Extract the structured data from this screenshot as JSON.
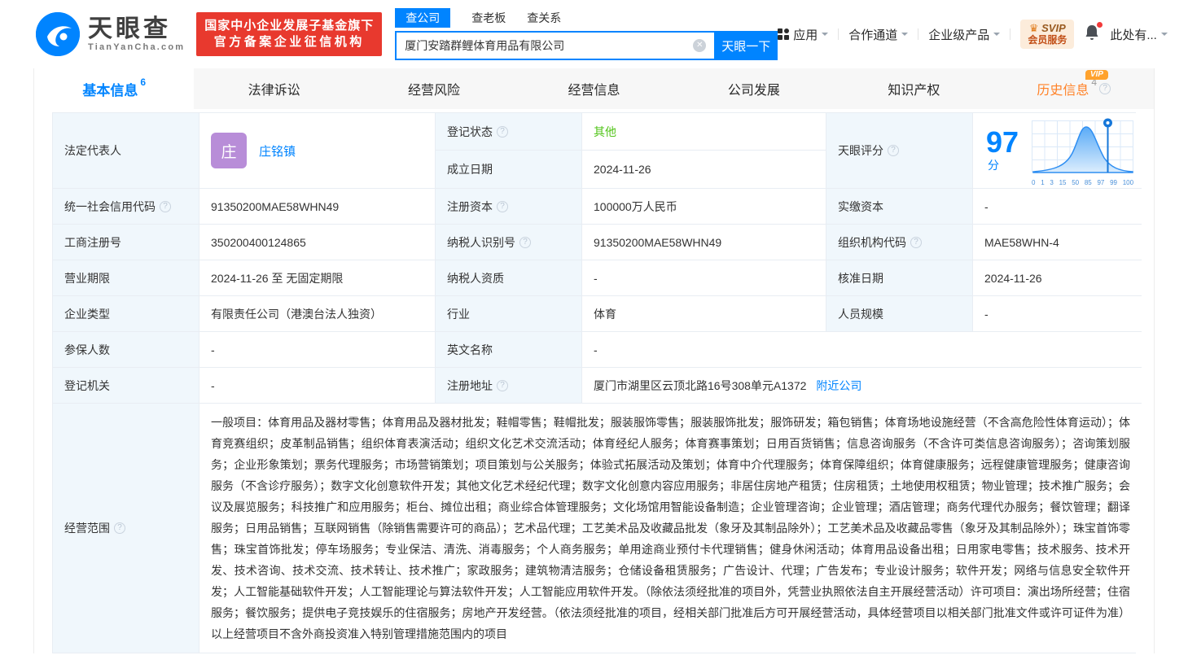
{
  "header": {
    "logo": {
      "title": "天眼查",
      "subtitle": "TianYanCha.com"
    },
    "gov_badge": {
      "line1": "国家中小企业发展子基金旗下",
      "line2": "官方备案企业征信机构"
    },
    "search": {
      "tabs": [
        {
          "label": "查公司"
        },
        {
          "label": "查老板"
        },
        {
          "label": "查关系"
        }
      ],
      "value": "厦门安踏群鲤体育用品有限公司",
      "button": "天眼一下"
    },
    "nav": {
      "apps": "应用",
      "partner": "合作通道",
      "enterprise": "企业级产品",
      "svip_line1": "SVIP",
      "svip_line2": "会员服务",
      "more": "此处有..."
    }
  },
  "tabs": [
    {
      "label": "基本信息",
      "count": "6"
    },
    {
      "label": "法律诉讼"
    },
    {
      "label": "经营风险"
    },
    {
      "label": "经营信息"
    },
    {
      "label": "公司发展"
    },
    {
      "label": "知识产权"
    },
    {
      "label": "历史信息",
      "count": "4",
      "vip_badge": "VIP"
    }
  ],
  "fields": {
    "legal_rep": {
      "label": "法定代表人",
      "avatar": "庄",
      "name": "庄铭镇"
    },
    "reg_status": {
      "label": "登记状态",
      "value": "其他"
    },
    "establish_date": {
      "label": "成立日期",
      "value": "2024-11-26"
    },
    "score": {
      "label": "天眼评分",
      "value": "97",
      "unit": "分"
    },
    "credit_code": {
      "label": "统一社会信用代码",
      "value": "91350200MAE58WHN49"
    },
    "reg_capital": {
      "label": "注册资本",
      "value": "100000万人民币"
    },
    "paid_capital": {
      "label": "实缴资本",
      "value": "-"
    },
    "reg_number": {
      "label": "工商注册号",
      "value": "350200400124865"
    },
    "taxpayer_id": {
      "label": "纳税人识别号",
      "value": "91350200MAE58WHN49"
    },
    "org_code": {
      "label": "组织机构代码",
      "value": "MAE58WHN-4"
    },
    "business_term": {
      "label": "营业期限",
      "value": "2024-11-26 至 无固定期限"
    },
    "taxpayer_quality": {
      "label": "纳税人资质",
      "value": "-"
    },
    "approval_date": {
      "label": "核准日期",
      "value": "2024-11-26"
    },
    "company_type": {
      "label": "企业类型",
      "value": "有限责任公司（港澳台法人独资）"
    },
    "industry": {
      "label": "行业",
      "value": "体育"
    },
    "staff_size": {
      "label": "人员规模",
      "value": "-"
    },
    "insured_count": {
      "label": "参保人数",
      "value": "-"
    },
    "english_name": {
      "label": "英文名称",
      "value": "-"
    },
    "reg_authority": {
      "label": "登记机关",
      "value": "-"
    },
    "reg_address": {
      "label": "注册地址",
      "value": "厦门市湖里区云顶北路16号308单元A1372",
      "link": "附近公司"
    },
    "business_scope": {
      "label": "经营范围",
      "value": "一般项目：体育用品及器材零售；体育用品及器材批发；鞋帽零售；鞋帽批发；服装服饰零售；服装服饰批发；服饰研发；箱包销售；体育场地设施经营（不含高危险性体育运动）；体育竞赛组织；皮革制品销售；组织体育表演活动；组织文化艺术交流活动；体育经纪人服务；体育赛事策划；日用百货销售；信息咨询服务（不含许可类信息咨询服务）；咨询策划服务；企业形象策划；票务代理服务；市场营销策划；项目策划与公关服务；体验式拓展活动及策划；体育中介代理服务；体育保障组织；体育健康服务；远程健康管理服务；健康咨询服务（不含诊疗服务）；数字文化创意软件开发；其他文化艺术经纪代理；数字文化创意内容应用服务；非居住房地产租赁；住房租赁；土地使用权租赁；物业管理；技术推广服务；会议及展览服务；科技推广和应用服务；柜台、摊位出租；商业综合体管理服务；文化场馆用智能设备制造；企业管理咨询；企业管理；酒店管理；商务代理代办服务；餐饮管理；翻译服务；日用品销售；互联网销售（除销售需要许可的商品）；艺术品代理；工艺美术品及收藏品批发（象牙及其制品除外）；工艺美术品及收藏品零售（象牙及其制品除外）；珠宝首饰零售；珠宝首饰批发；停车场服务；专业保洁、清洗、消毒服务；个人商务服务；单用途商业预付卡代理销售；健身休闲活动；体育用品设备出租；日用家电零售；技术服务、技术开发、技术咨询、技术交流、技术转让、技术推广；家政服务；建筑物清洁服务；仓储设备租赁服务；广告设计、代理；广告发布；专业设计服务；软件开发；网络与信息安全软件开发；人工智能基础软件开发；人工智能理论与算法软件开发；人工智能应用软件开发。（除依法须经批准的项目外，凭营业执照依法自主开展经营活动）许可项目：演出场所经营；住宿服务；餐饮服务；提供电子竞技娱乐的住宿服务；房地产开发经营。（依法须经批准的项目，经相关部门批准后方可开展经营活动，具体经营项目以相关部门批准文件或许可证件为准）以上经营项目不含外商投资准入特别管理措施范围内的项目"
    }
  },
  "score_chart": {
    "type": "area",
    "labels": [
      "0",
      "1",
      "3",
      "15",
      "50",
      "85",
      "97",
      "99",
      "100"
    ],
    "marker_at": "97",
    "accent_color": "#2e8ef2"
  },
  "colors": {
    "brand_blue": "#0084ff",
    "badge_red": "#e8392e",
    "status_green": "#52c41a",
    "history_orange": "#ff8228"
  }
}
